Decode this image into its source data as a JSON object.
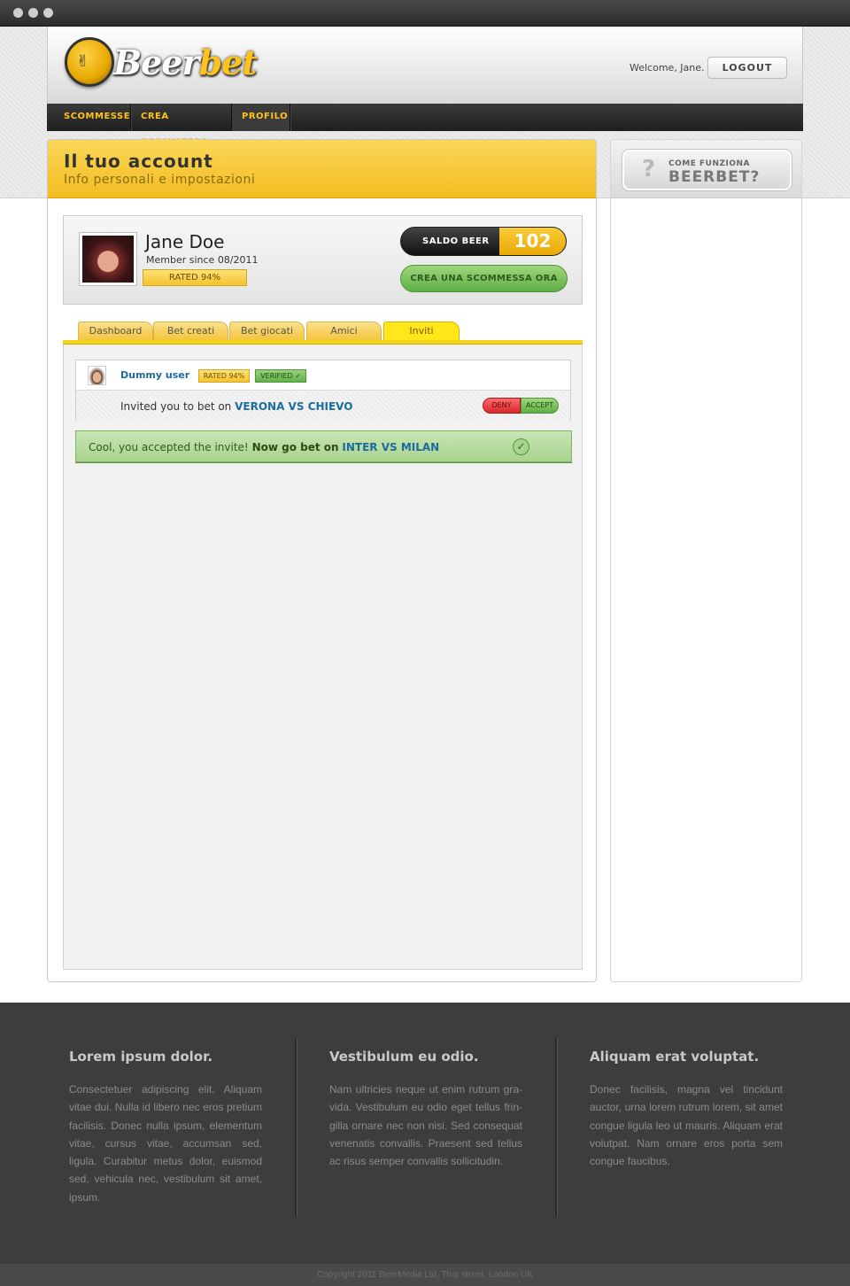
{
  "brand": {
    "name_part1": "Beer",
    "name_part2": "bet",
    "colors": {
      "yellow": "#f5c22c",
      "dark": "#2b2b2b",
      "green": "#5fae45",
      "blue": "#1b6c9c"
    }
  },
  "header": {
    "welcome": "Welcome, Jane.",
    "logout": "LOGOUT"
  },
  "nav": {
    "items": [
      "SCOMMESSE",
      "CREA SCOMMESSA",
      "PROFILO"
    ],
    "active": "PROFILO"
  },
  "page": {
    "title": "Il tuo account",
    "subtitle": "Info personali e impostazioni"
  },
  "profile": {
    "name": "Jane Doe",
    "member_since": "Member since 08/2011",
    "rating": "RATED 94%",
    "saldo_label": "SALDO BEER",
    "saldo_value": "102",
    "cta": "CREA UNA SCOMMESSA ORA"
  },
  "tabs": [
    "Dashboard",
    "Bet creati",
    "Bet giocati",
    "Amici",
    "Inviti"
  ],
  "active_tab": "Inviti",
  "invite": {
    "user": "Dummy user",
    "rating": "RATED 94%",
    "verified": "VERIFIED",
    "text": "Invited you to bet on",
    "match": "VERONA VS CHIEVO",
    "deny": "DENY",
    "accept": "ACCEPT"
  },
  "success": {
    "text": "Cool, you accepted the invite!",
    "cta": "Now go bet on",
    "match": "INTER VS MILAN"
  },
  "sidebar": {
    "how_small": "COME FUNZIONA",
    "how_big": "BEERBET?"
  },
  "footer": {
    "columns": [
      {
        "title": "Lorem ipsum dolor.",
        "text": "Consectetuer adipiscing elit. Aliquam vitae dui. Nulla id libero nec eros pretium facilisis. Donec nulla ipsum, elementum vitae, cursus vitae, accumsan sed, ligula. Curabitur metus dolor, euismod sed, vehicula nec, vestibulum sit amet, ipsum."
      },
      {
        "title": "Vestibulum eu odio.",
        "text": "Nam ultricies neque ut enim rutrum gra-vida. Vestibulum eu odio eget tellus frin-gilla ornare nec non nisi. Sed consequat venenatis convallis. Praesent sed tellus ac risus semper convallis sollicitudin."
      },
      {
        "title": "Aliquam erat voluptat.",
        "text": "Donec facilisis, magna vel tincidunt auctor, urna lorem rutrum lorem, sit amet congue ligula leo ut mauris. Aliquam erat volutpat. Nam ornare eros porta sem congue faucibus."
      }
    ],
    "copyright": "Copyright 2011 BeerMedia Ltd, That street, London UK"
  }
}
